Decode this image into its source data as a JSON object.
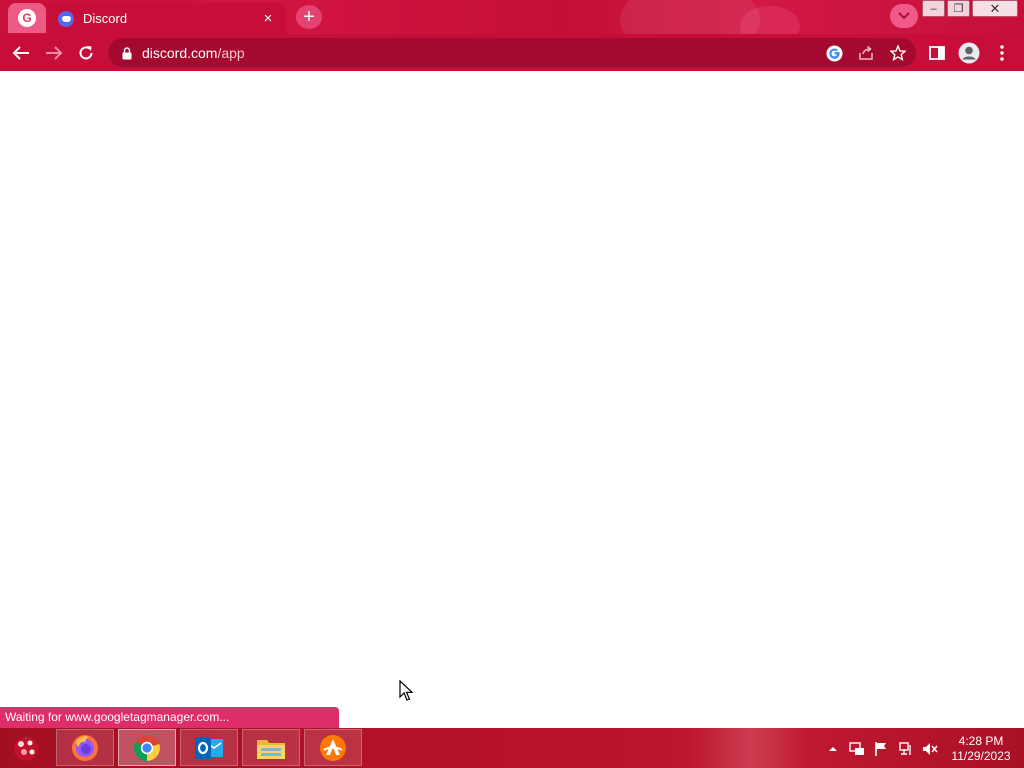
{
  "browser": {
    "tab_group": {
      "letter": "G"
    },
    "active_tab": {
      "title": "Discord",
      "close_glyph": "×"
    },
    "new_tab_glyph": "+",
    "address": {
      "host": "discord.com",
      "path": "/app"
    },
    "window_controls": {
      "minimize": "–",
      "restore": "❐",
      "close": "✕"
    },
    "icons": [
      "back-arrow-icon",
      "forward-arrow-icon",
      "reload-icon",
      "lock-icon",
      "google-lens-icon",
      "share-icon",
      "bookmark-star-icon",
      "side-panel-icon",
      "profile-avatar-icon",
      "menu-dots-icon",
      "tab-search-chevron-icon"
    ]
  },
  "status_bar": {
    "text": "Waiting for www.googletagmanager.com..."
  },
  "taskbar": {
    "apps": [
      "Firefox",
      "Chrome",
      "Outlook",
      "File Explorer",
      "Avast"
    ],
    "clock": {
      "time": "4:28 PM",
      "date": "11/29/2023"
    },
    "tray_icons": [
      "show-hidden-icons-arrow",
      "network-icon",
      "action-center-flag-icon",
      "display-icon",
      "volume-muted-icon"
    ]
  },
  "colors": {
    "chrome_accent": "#c70e3b",
    "omnibox": "#a40a30",
    "status_bubble": "#df2d6b",
    "taskbar": "#b31228"
  }
}
